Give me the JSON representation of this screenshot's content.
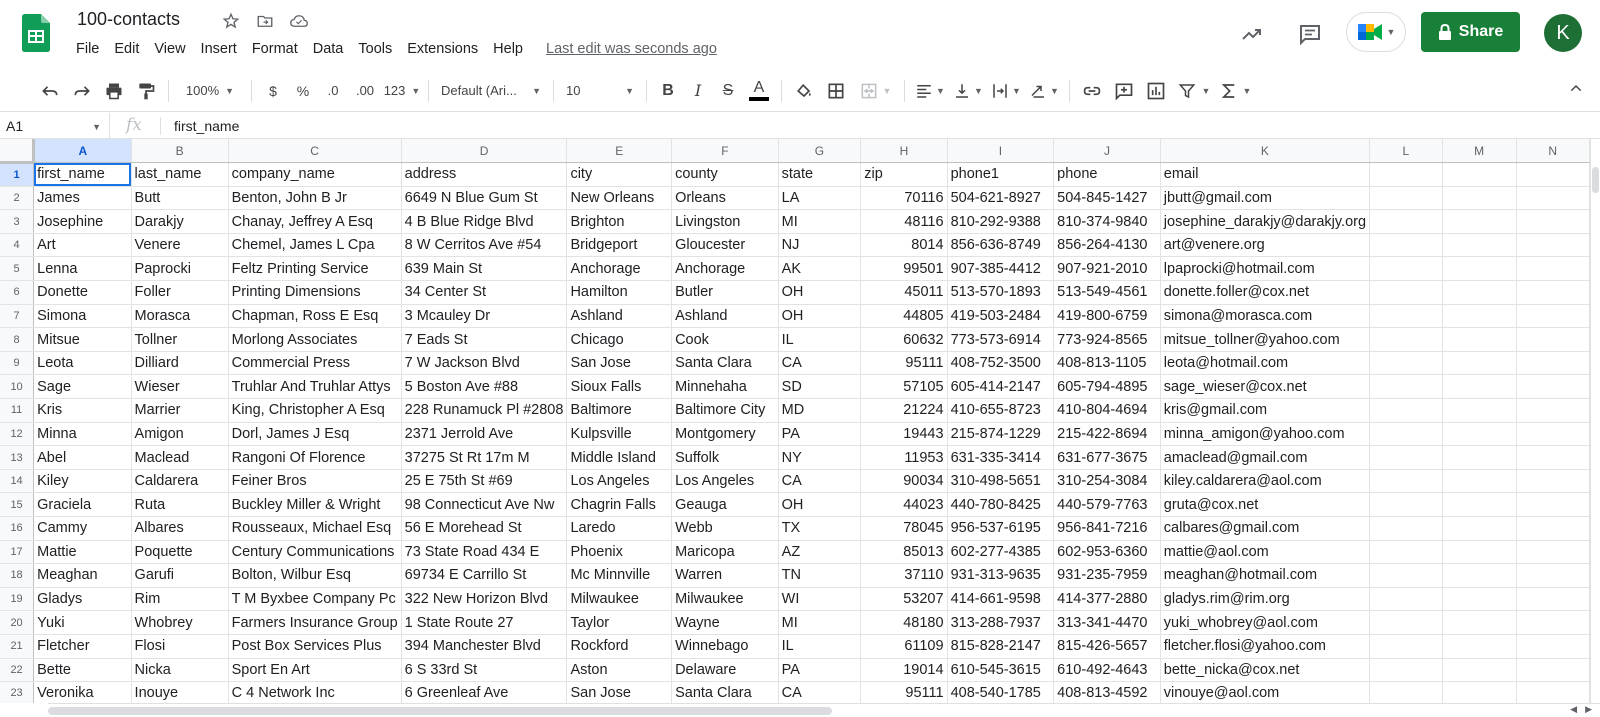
{
  "header": {
    "title": "100-contacts",
    "last_edit": "Last edit was seconds ago",
    "share_label": "Share",
    "avatar_letter": "K",
    "brand_color": "#188038"
  },
  "menu": [
    "File",
    "Edit",
    "View",
    "Insert",
    "Format",
    "Data",
    "Tools",
    "Extensions",
    "Help"
  ],
  "toolbar": {
    "zoom": "100%",
    "currency": "$",
    "percent": "%",
    "dec_decrease": ".0",
    "dec_increase": ".00",
    "more_formats": "123",
    "font": "Default (Ari...",
    "font_size": "10",
    "bold": "B",
    "italic": "I",
    "strike": "S",
    "text_color": "A"
  },
  "formula_bar": {
    "cell_ref": "A1",
    "fx": "fx",
    "value": "first_name"
  },
  "columns": [
    "A",
    "B",
    "C",
    "D",
    "E",
    "F",
    "G",
    "H",
    "I",
    "J",
    "K",
    "L",
    "M",
    "N"
  ],
  "rows": [
    [
      "first_name",
      "last_name",
      "company_name",
      "address",
      "city",
      "county",
      "state",
      "zip",
      "phone1",
      "phone",
      "email"
    ],
    [
      "James",
      "Butt",
      "Benton, John B Jr",
      "6649 N Blue Gum St",
      "New Orleans",
      "Orleans",
      "LA",
      "70116",
      "504-621-8927",
      "504-845-1427",
      "jbutt@gmail.com"
    ],
    [
      "Josephine",
      "Darakjy",
      "Chanay, Jeffrey A Esq",
      "4 B Blue Ridge Blvd",
      "Brighton",
      "Livingston",
      "MI",
      "48116",
      "810-292-9388",
      "810-374-9840",
      "josephine_darakjy@darakjy.org"
    ],
    [
      "Art",
      "Venere",
      "Chemel, James L Cpa",
      "8 W Cerritos Ave #54",
      "Bridgeport",
      "Gloucester",
      "NJ",
      "8014",
      "856-636-8749",
      "856-264-4130",
      "art@venere.org"
    ],
    [
      "Lenna",
      "Paprocki",
      "Feltz Printing Service",
      "639 Main St",
      "Anchorage",
      "Anchorage",
      "AK",
      "99501",
      "907-385-4412",
      "907-921-2010",
      "lpaprocki@hotmail.com"
    ],
    [
      "Donette",
      "Foller",
      "Printing Dimensions",
      "34 Center St",
      "Hamilton",
      "Butler",
      "OH",
      "45011",
      "513-570-1893",
      "513-549-4561",
      "donette.foller@cox.net"
    ],
    [
      "Simona",
      "Morasca",
      "Chapman, Ross E Esq",
      "3 Mcauley Dr",
      "Ashland",
      "Ashland",
      "OH",
      "44805",
      "419-503-2484",
      "419-800-6759",
      "simona@morasca.com"
    ],
    [
      "Mitsue",
      "Tollner",
      "Morlong Associates",
      "7 Eads St",
      "Chicago",
      "Cook",
      "IL",
      "60632",
      "773-573-6914",
      "773-924-8565",
      "mitsue_tollner@yahoo.com"
    ],
    [
      "Leota",
      "Dilliard",
      "Commercial Press",
      "7 W Jackson Blvd",
      "San Jose",
      "Santa Clara",
      "CA",
      "95111",
      "408-752-3500",
      "408-813-1105",
      "leota@hotmail.com"
    ],
    [
      "Sage",
      "Wieser",
      "Truhlar And Truhlar Attys",
      "5 Boston Ave #88",
      "Sioux Falls",
      "Minnehaha",
      "SD",
      "57105",
      "605-414-2147",
      "605-794-4895",
      "sage_wieser@cox.net"
    ],
    [
      "Kris",
      "Marrier",
      "King, Christopher A Esq",
      "228 Runamuck Pl #2808",
      "Baltimore",
      "Baltimore City",
      "MD",
      "21224",
      "410-655-8723",
      "410-804-4694",
      "kris@gmail.com"
    ],
    [
      "Minna",
      "Amigon",
      "Dorl, James J Esq",
      "2371 Jerrold Ave",
      "Kulpsville",
      "Montgomery",
      "PA",
      "19443",
      "215-874-1229",
      "215-422-8694",
      "minna_amigon@yahoo.com"
    ],
    [
      "Abel",
      "Maclead",
      "Rangoni Of Florence",
      "37275 St  Rt 17m M",
      "Middle Island",
      "Suffolk",
      "NY",
      "11953",
      "631-335-3414",
      "631-677-3675",
      "amaclead@gmail.com"
    ],
    [
      "Kiley",
      "Caldarera",
      "Feiner Bros",
      "25 E 75th St #69",
      "Los Angeles",
      "Los Angeles",
      "CA",
      "90034",
      "310-498-5651",
      "310-254-3084",
      "kiley.caldarera@aol.com"
    ],
    [
      "Graciela",
      "Ruta",
      "Buckley Miller & Wright",
      "98 Connecticut Ave Nw",
      "Chagrin Falls",
      "Geauga",
      "OH",
      "44023",
      "440-780-8425",
      "440-579-7763",
      "gruta@cox.net"
    ],
    [
      "Cammy",
      "Albares",
      "Rousseaux, Michael Esq",
      "56 E Morehead St",
      "Laredo",
      "Webb",
      "TX",
      "78045",
      "956-537-6195",
      "956-841-7216",
      "calbares@gmail.com"
    ],
    [
      "Mattie",
      "Poquette",
      "Century Communications",
      "73 State Road 434 E",
      "Phoenix",
      "Maricopa",
      "AZ",
      "85013",
      "602-277-4385",
      "602-953-6360",
      "mattie@aol.com"
    ],
    [
      "Meaghan",
      "Garufi",
      "Bolton, Wilbur Esq",
      "69734 E Carrillo St",
      "Mc Minnville",
      "Warren",
      "TN",
      "37110",
      "931-313-9635",
      "931-235-7959",
      "meaghan@hotmail.com"
    ],
    [
      "Gladys",
      "Rim",
      "T M Byxbee Company Pc",
      "322 New Horizon Blvd",
      "Milwaukee",
      "Milwaukee",
      "WI",
      "53207",
      "414-661-9598",
      "414-377-2880",
      "gladys.rim@rim.org"
    ],
    [
      "Yuki",
      "Whobrey",
      "Farmers Insurance Group",
      "1 State Route 27",
      "Taylor",
      "Wayne",
      "MI",
      "48180",
      "313-288-7937",
      "313-341-4470",
      "yuki_whobrey@aol.com"
    ],
    [
      "Fletcher",
      "Flosi",
      "Post Box Services Plus",
      "394 Manchester Blvd",
      "Rockford",
      "Winnebago",
      "IL",
      "61109",
      "815-828-2147",
      "815-426-5657",
      "fletcher.flosi@yahoo.com"
    ],
    [
      "Bette",
      "Nicka",
      "Sport En Art",
      "6 S 33rd St",
      "Aston",
      "Delaware",
      "PA",
      "19014",
      "610-545-3615",
      "610-492-4643",
      "bette_nicka@cox.net"
    ],
    [
      "Veronika",
      "Inouye",
      "C 4 Network Inc",
      "6 Greenleaf Ave",
      "San Jose",
      "Santa Clara",
      "CA",
      "95111",
      "408-540-1785",
      "408-813-4592",
      "vinouye@aol.com"
    ]
  ]
}
